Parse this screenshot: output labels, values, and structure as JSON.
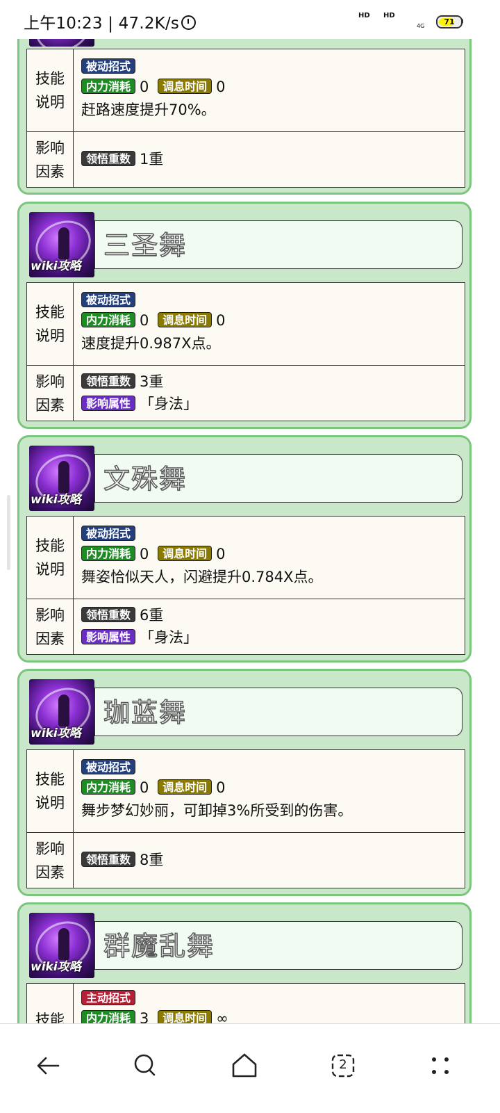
{
  "status_bar": {
    "time": "上午10:23 | 47.2K/s",
    "hd1": "HD",
    "hd2": "HD",
    "signal": "4G",
    "battery": "71"
  },
  "partial_card": {
    "row1": {
      "label": "技能\n说明",
      "type_tag": "被动招式",
      "neili_tag": "内力消耗",
      "neili_value": "0",
      "tiaoxi_tag": "调息时间",
      "tiaoxi_value": "0",
      "desc": "赶路速度提升70%。"
    },
    "row2": {
      "label": "影响\n因素",
      "lingwu_tag": "领悟重数",
      "lingwu_value": "1重"
    }
  },
  "cards": [
    {
      "name": "三圣舞",
      "watermark": "wiki攻略",
      "type_tag": "被动招式",
      "neili_tag": "内力消耗",
      "neili_value": "0",
      "tiaoxi_tag": "调息时间",
      "tiaoxi_value": "0",
      "desc": "速度提升0.987X点。",
      "lingwu_tag": "领悟重数",
      "lingwu_value": "3重",
      "shuxing_tag": "影响属性",
      "shuxing_value": "「身法」"
    },
    {
      "name": "文殊舞",
      "watermark": "wiki攻略",
      "type_tag": "被动招式",
      "neili_tag": "内力消耗",
      "neili_value": "0",
      "tiaoxi_tag": "调息时间",
      "tiaoxi_value": "0",
      "desc": "舞姿恰似天人，闪避提升0.784X点。",
      "lingwu_tag": "领悟重数",
      "lingwu_value": "6重",
      "shuxing_tag": "影响属性",
      "shuxing_value": "「身法」"
    },
    {
      "name": "珈蓝舞",
      "watermark": "wiki攻略",
      "type_tag": "被动招式",
      "neili_tag": "内力消耗",
      "neili_value": "0",
      "tiaoxi_tag": "调息时间",
      "tiaoxi_value": "0",
      "desc": "舞步梦幻妙丽，可卸掉3%所受到的伤害。",
      "lingwu_tag": "领悟重数",
      "lingwu_value": "8重"
    },
    {
      "name": "群魔乱舞",
      "watermark": "wiki攻略",
      "type_tag": "主动招式",
      "neili_tag": "内力消耗",
      "neili_value": "3",
      "tiaoxi_tag": "调息时间",
      "tiaoxi_value": "∞"
    }
  ],
  "labels": {
    "skill_desc": "技能\n说明",
    "factors": "影响\n因素"
  },
  "nav": {
    "back": "back",
    "search": "search",
    "home": "home",
    "tabs_count": "2",
    "menu": "menu"
  }
}
